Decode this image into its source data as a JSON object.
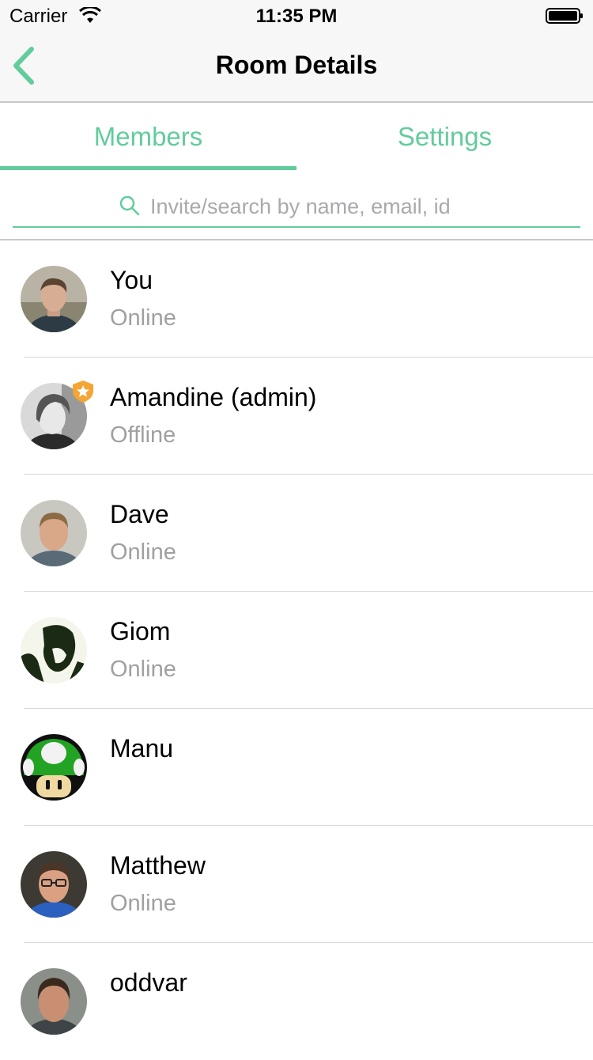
{
  "status_bar": {
    "carrier": "Carrier",
    "time": "11:35 PM"
  },
  "nav": {
    "title": "Room Details"
  },
  "tabs": [
    {
      "label": "Members",
      "selected": true
    },
    {
      "label": "Settings",
      "selected": false
    }
  ],
  "search": {
    "placeholder": "Invite/search by name, email, id",
    "value": ""
  },
  "members": [
    {
      "name": "You",
      "presence": "Online"
    },
    {
      "name": "Amandine (admin)",
      "presence": "Offline",
      "admin_badge": "star-shield-icon"
    },
    {
      "name": "Dave",
      "presence": "Online"
    },
    {
      "name": "Giom",
      "presence": "Online"
    },
    {
      "name": "Manu",
      "presence": ""
    },
    {
      "name": "Matthew",
      "presence": "Online"
    },
    {
      "name": "oddvar",
      "presence": ""
    }
  ],
  "colors": {
    "accent": "#62cc9c",
    "admin_badge": "#f4a533",
    "secondary_text": "#a0a0a0"
  }
}
